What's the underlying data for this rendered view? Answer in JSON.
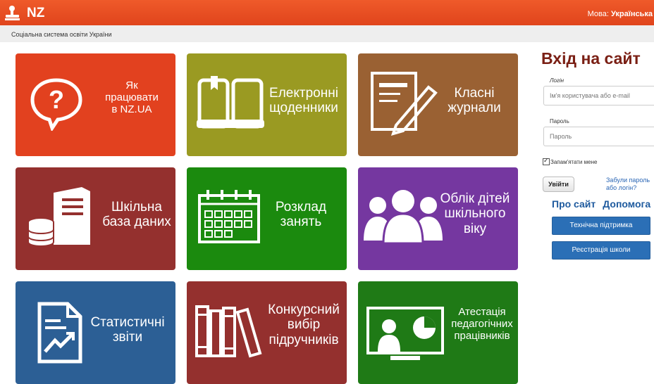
{
  "header": {
    "logo_text": "NZ",
    "language_label": "Мова:",
    "language_value": "Українська"
  },
  "subheader": {
    "tagline": "Соціальна система освіти України"
  },
  "tiles": [
    {
      "lines": [
        "Як",
        "працювати",
        "в NZ.UA"
      ],
      "icon": "question-bubble-icon",
      "color": "#e2411f"
    },
    {
      "lines": [
        "Електронні",
        "щоденники"
      ],
      "icon": "open-book-icon",
      "color": "#9a9a22"
    },
    {
      "lines": [
        "Класні",
        "журнали"
      ],
      "icon": "document-pencil-icon",
      "color": "#9a6133"
    },
    {
      "lines": [
        "Шкільна",
        "база даних"
      ],
      "icon": "database-server-icon",
      "color": "#94302e"
    },
    {
      "lines": [
        "Розклад",
        "занять"
      ],
      "icon": "calendar-icon",
      "color": "#1b8a0e"
    },
    {
      "lines": [
        "Облік дітей",
        "шкільного",
        "віку"
      ],
      "icon": "people-group-icon",
      "color": "#7537a0"
    },
    {
      "lines": [
        "Статистичні",
        "звіти"
      ],
      "icon": "report-chart-icon",
      "color": "#2c5f95"
    },
    {
      "lines": [
        "Конкурсний",
        "вибір",
        "підручників"
      ],
      "icon": "books-icon",
      "color": "#94302e"
    },
    {
      "lines": [
        "Атестація",
        "педагогічних",
        "працівників"
      ],
      "icon": "presentation-teacher-icon",
      "color": "#1f7a16"
    }
  ],
  "login": {
    "title": "Вхід на сайт",
    "login_label": "Логін",
    "login_placeholder": "Ім'я користувача або e-mail",
    "password_label": "Пароль",
    "password_placeholder": "Пароль",
    "remember_label": "Запам'ятати мене",
    "remember_checked": true,
    "submit_label": "Увійти",
    "forgot_label": "Забули пароль або логін?",
    "about_link": "Про сайт",
    "help_link": "Допомога",
    "support_button": "Технічна підтримка",
    "register_button": "Реєстрація школи"
  }
}
